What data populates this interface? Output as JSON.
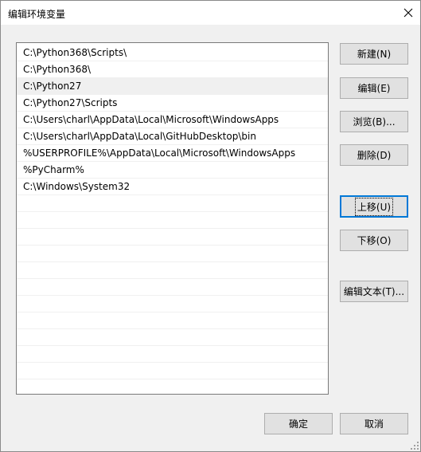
{
  "window": {
    "title": "编辑环境变量"
  },
  "paths": [
    "C:\\Python368\\Scripts\\",
    "C:\\Python368\\",
    "C:\\Python27",
    "C:\\Python27\\Scripts",
    "C:\\Users\\charl\\AppData\\Local\\Microsoft\\WindowsApps",
    "C:\\Users\\charl\\AppData\\Local\\GitHubDesktop\\bin",
    "%USERPROFILE%\\AppData\\Local\\Microsoft\\WindowsApps",
    "%PyCharm%",
    "C:\\Windows\\System32",
    "",
    "",
    "",
    "",
    "",
    "",
    "",
    "",
    "",
    "",
    "",
    ""
  ],
  "selected_index": 2,
  "buttons": {
    "new": "新建(N)",
    "edit": "编辑(E)",
    "browse": "浏览(B)...",
    "delete": "删除(D)",
    "move_up": "上移(U)",
    "move_down": "下移(O)",
    "edit_text": "编辑文本(T)...",
    "ok": "确定",
    "cancel": "取消"
  },
  "icons": {
    "close": "close-icon",
    "grip": "resize-grip-icon"
  },
  "colors": {
    "focus": "#0078d7",
    "selected_row": "#f0f0f0",
    "button_face": "#e1e1e1"
  }
}
